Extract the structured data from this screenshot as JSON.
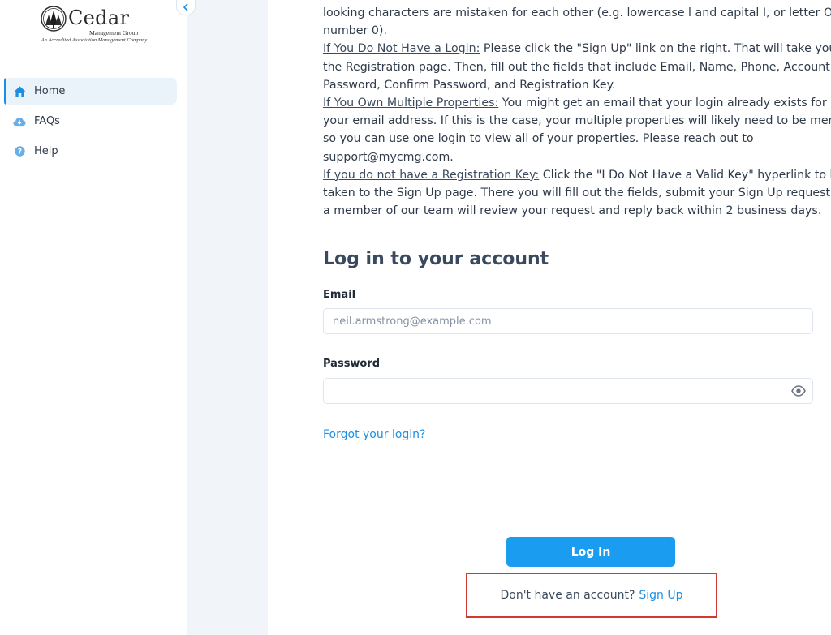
{
  "brand": {
    "name": "Cedar",
    "subname": "Management Group",
    "tagline": "An Accredited Association Management Company"
  },
  "sidebar": {
    "items": [
      {
        "label": "Home",
        "icon": "home-icon",
        "active": true
      },
      {
        "label": "FAQs",
        "icon": "cloud-icon",
        "active": false
      },
      {
        "label": "Help",
        "icon": "question-icon",
        "active": false
      }
    ]
  },
  "instructions": {
    "line0": "looking characters are mistaken for each other (e.g. lowercase l and capital I, or letter O",
    "line1": "number 0).",
    "no_login_heading": "If You Do Not Have a Login:",
    "no_login_l1": " Please click the \"Sign Up\" link on the right. That will take you",
    "no_login_l2": "the Registration page. Then, fill out the fields that include Email, Name, Phone, Account,",
    "no_login_l3": "Password, Confirm Password, and Registration Key.",
    "multi_heading": "If You Own Multiple Properties:",
    "multi_l1": " You might get an email that your login already exists for",
    "multi_l2": "your email address. If this is the case, your multiple properties will likely need to be merged",
    "multi_l3": "so you can use one login to view all of your properties. Please reach out to",
    "multi_l4": "support@mycmg.com.",
    "nokey_heading": "If you do not have a Registration Key:",
    "nokey_l1": " Click the \"I Do Not Have a Valid Key\" hyperlink to be",
    "nokey_l2": "taken to the Sign Up page. There you will fill out the fields, submit your Sign Up request, and",
    "nokey_l3": "a member of our team will review your request and reply back within 2 business days."
  },
  "login": {
    "title": "Log in to your account",
    "email_label": "Email",
    "email_placeholder": "neil.armstrong@example.com",
    "password_label": "Password",
    "password_value": "",
    "forgot_link": "Forgot your login?",
    "submit_label": "Log In",
    "signup_prompt": "Don't have an account?",
    "signup_link": "Sign Up"
  },
  "colors": {
    "accent": "#1a9cf0",
    "link": "#1a8fe3",
    "highlight_border": "#cc3a33",
    "gutter": "#f1f5f9"
  }
}
